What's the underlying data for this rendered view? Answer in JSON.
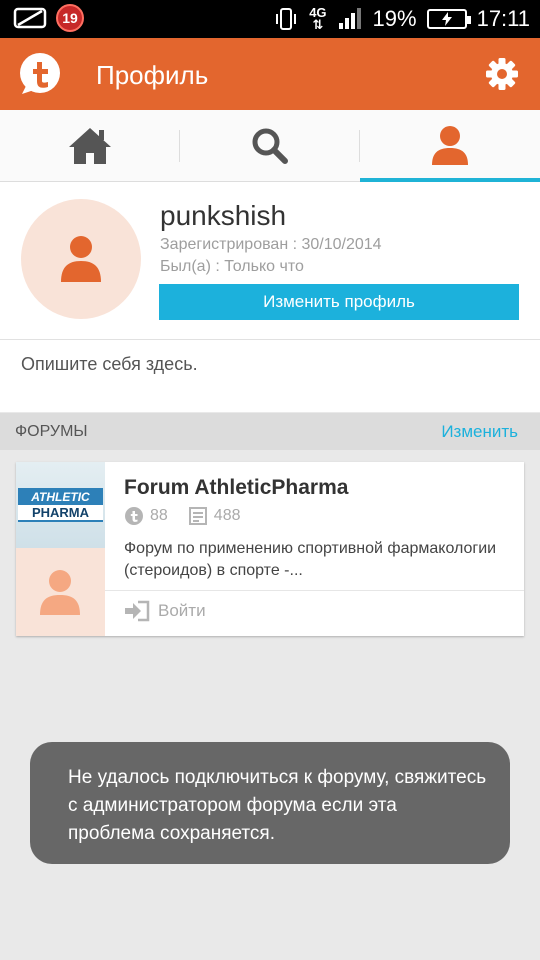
{
  "status_bar": {
    "notification_count": "19",
    "network": "4G",
    "battery": "19%",
    "time": "17:11"
  },
  "app_bar": {
    "title": "Профиль",
    "accent": "#e3662e"
  },
  "tabs": [
    {
      "name": "home",
      "icon": "home-icon",
      "active": false
    },
    {
      "name": "search",
      "icon": "search-icon",
      "active": false
    },
    {
      "name": "profile",
      "icon": "user-icon",
      "active": true
    }
  ],
  "profile": {
    "username": "punkshish",
    "registered": "Зарегистрирован : 30/10/2014",
    "last_seen": "Был(а) : Только что",
    "edit_label": "Изменить профиль",
    "about_placeholder": "Опишите себя здесь."
  },
  "forums": {
    "title": "ФОРУМЫ",
    "edit_label": "Изменить",
    "items": [
      {
        "logo_line1": "ATHLETIC",
        "logo_line2": "PHARMA",
        "name": "Forum AthleticPharma",
        "members": "88",
        "posts": "488",
        "description": "Форум по применению спортивной фармакологии (стероидов) в спорте -...",
        "login_label": "Войти"
      }
    ]
  },
  "toast": {
    "message": "Не удалось подключиться к форуму, свяжитесь с администратором форума если эта проблема сохраняется."
  }
}
